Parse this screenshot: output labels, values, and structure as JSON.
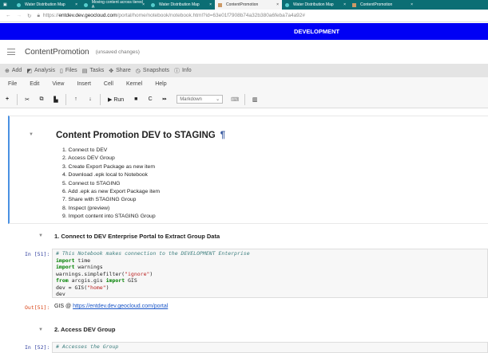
{
  "browser": {
    "tabs": [
      "Water Distribution Map",
      "Moving content across tiered A",
      "Water Distribution Map",
      "ContentPromotion",
      "Water Distribution Map",
      "ContentPromotion"
    ],
    "active_tab": 3,
    "url_prefix": "https://",
    "url_host": "entdev.dev.geocloud.com",
    "url_path": "/portal/home/notebook/notebook.html?id=63e01f7908b74a32b380a6feba7a4a92#"
  },
  "banner": "DEVELOPMENT",
  "header": {
    "notebook_name": "ContentPromotion",
    "status": "(unsaved changes)"
  },
  "toolbar": [
    "Add",
    "Analysis",
    "Files",
    "Tasks",
    "Share",
    "Snapshots",
    "Info"
  ],
  "menu": [
    "File",
    "Edit",
    "View",
    "Insert",
    "Cell",
    "Kernel",
    "Help"
  ],
  "nb_toolbar": {
    "run": "Run",
    "cell_type": "Markdown"
  },
  "markdown": {
    "title": "Content Promotion DEV to STAGING",
    "pilcrow": "¶",
    "steps": [
      "1. Connect to DEV",
      "2. Access DEV Group",
      "3. Create Export Package as new item",
      "4. Download .epk local to Notebook",
      "5. Connect to STAGING",
      "6. Add .epk as new Export Package item",
      "7. Share with STAGING Group",
      "8. Inspect (preview)",
      "9. Import content into STAGING Group"
    ]
  },
  "section1": "1. Connect to DEV Enterprise Portal to Extract Group Data",
  "cell51": {
    "prompt": "In [51]:",
    "lines": [
      "# This Notebook makes connection to the DEVELOPMENT Enterprise",
      "import time",
      "import warnings",
      "warnings.simplefilter(\"ignore\")",
      "from arcgis.gis import GIS",
      "dev = GIS(\"home\")",
      "dev"
    ],
    "out_prompt": "Out[51]:",
    "out_prefix": "GIS @ ",
    "out_link": "https://entdev.dev.geocloud.com/portal"
  },
  "section2": "2. Access DEV Group",
  "cell52": {
    "prompt": "In [52]:",
    "line": "# Accesses the Group"
  }
}
